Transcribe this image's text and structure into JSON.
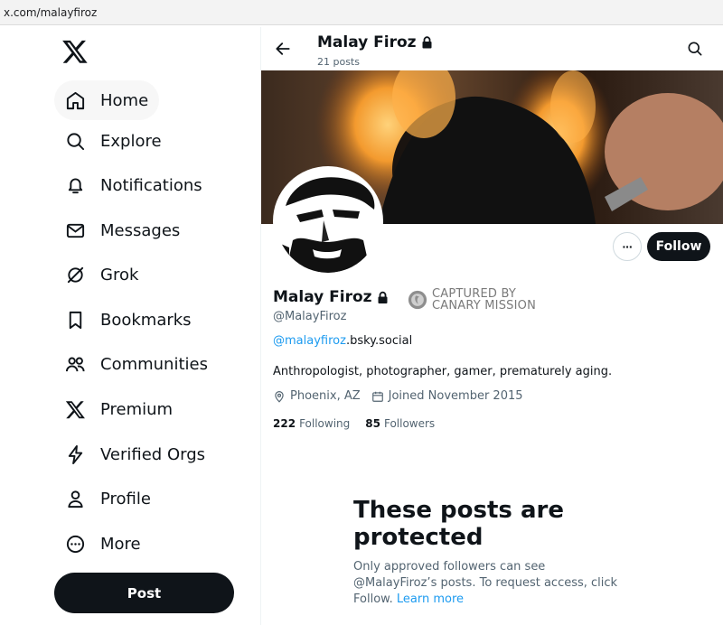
{
  "browser": {
    "url": "x.com/malayfiroz"
  },
  "sidebar": {
    "logo_icon": "x-logo-icon",
    "items": [
      {
        "label": "Home",
        "icon": "home-icon"
      },
      {
        "label": "Explore",
        "icon": "search-icon"
      },
      {
        "label": "Notifications",
        "icon": "bell-icon"
      },
      {
        "label": "Messages",
        "icon": "envelope-icon"
      },
      {
        "label": "Grok",
        "icon": "grok-icon"
      },
      {
        "label": "Bookmarks",
        "icon": "bookmark-icon"
      },
      {
        "label": "Communities",
        "icon": "people-icon"
      },
      {
        "label": "Premium",
        "icon": "x-logo-icon"
      },
      {
        "label": "Verified Orgs",
        "icon": "lightning-icon"
      },
      {
        "label": "Profile",
        "icon": "person-icon"
      },
      {
        "label": "More",
        "icon": "more-circle-icon"
      }
    ],
    "post_label": "Post"
  },
  "header": {
    "name": "Malay Firoz",
    "post_count": "21 posts"
  },
  "profile": {
    "name": "Malay Firoz",
    "handle": "@MalayFiroz",
    "more_label": "···",
    "follow_label": "Follow",
    "captured_line1": "CAPTURED BY",
    "captured_line2": "CANARY MISSION",
    "website_link": "@malayfiroz",
    "website_rest": ".bsky.social",
    "bio": "Anthropologist, photographer, gamer, prematurely aging.",
    "location": "Phoenix, AZ",
    "joined": "Joined November 2015",
    "following_count": "222",
    "following_label": "Following",
    "followers_count": "85",
    "followers_label": "Followers"
  },
  "protected": {
    "title": "These posts are protected",
    "body": "Only approved followers can see @MalayFiroz’s posts. To request access, click Follow.",
    "learn_more": "Learn more"
  },
  "colors": {
    "accent": "#1d9bf0",
    "text": "#0f1419",
    "secondary": "#536471"
  }
}
